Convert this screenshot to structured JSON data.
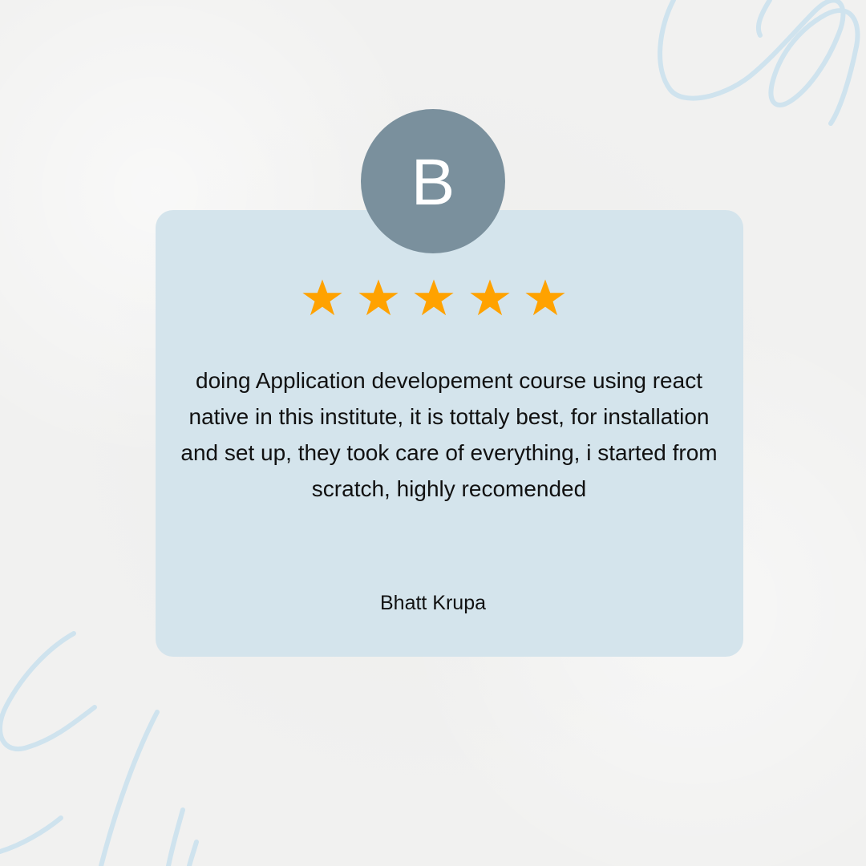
{
  "avatar": {
    "letter": "B",
    "color": "#7a909d"
  },
  "rating": {
    "value": 5,
    "max": 5,
    "star_color": "#ffa200"
  },
  "review": {
    "text": "doing Application developement course using react native in this institute, it is tottaly best, for installation and set up, they took care of everything, i started from scratch, highly recomended"
  },
  "reviewer": {
    "name": "Bhatt Krupa"
  },
  "colors": {
    "background": "#f1f1f0",
    "card": "#d4e4ec",
    "accent_lines": "#cfe3ee",
    "text": "#111111"
  }
}
